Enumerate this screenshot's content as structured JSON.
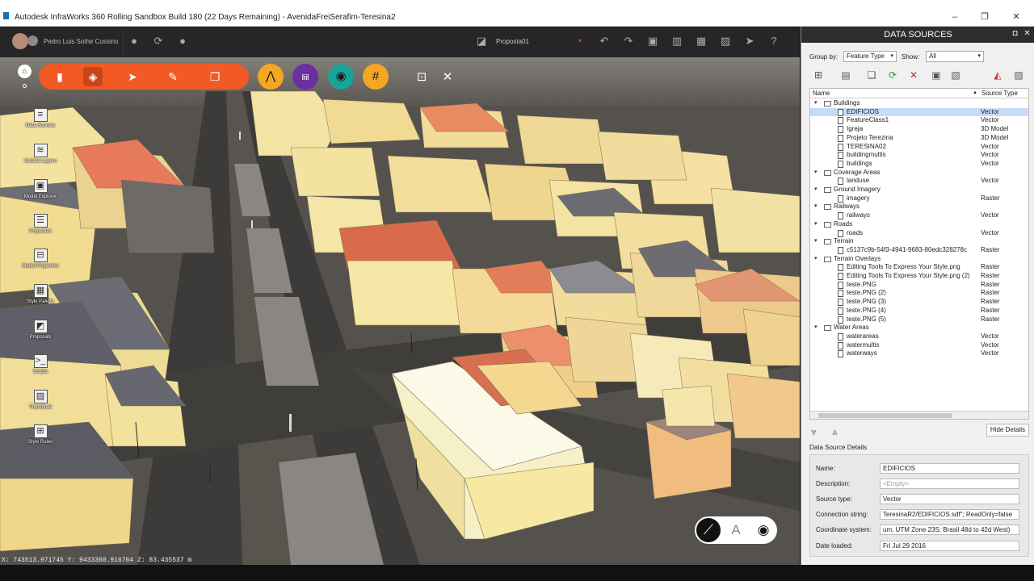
{
  "window": {
    "title": "Autodesk InfraWorks 360 Rolling Sandbox Build 180 (22 Days Remaining) - AvenidaFreiSerafim-Teresina2",
    "minimize": "–",
    "maximize": "❐",
    "close": "✕"
  },
  "topbar": {
    "user": "Pedro Luis Sothe Cussino",
    "proposal": "Proposta01",
    "proposal_caret": "▾"
  },
  "left_tools": [
    {
      "label": "Data Sources",
      "icon": "database-icon",
      "glyph": "≡"
    },
    {
      "label": "Surface Layers",
      "icon": "layers-icon",
      "glyph": "≋"
    },
    {
      "label": "Model Explorer",
      "icon": "model-explorer-icon",
      "glyph": "▣"
    },
    {
      "label": "Properties",
      "icon": "properties-icon",
      "glyph": "☰"
    },
    {
      "label": "Model Properties",
      "icon": "model-properties-icon",
      "glyph": "⊟"
    },
    {
      "label": "Style Palette",
      "icon": "style-palette-icon",
      "glyph": "▦"
    },
    {
      "label": "Proposals",
      "icon": "proposals-icon",
      "glyph": "◩"
    },
    {
      "label": "Scripts",
      "icon": "scripts-icon",
      "glyph": ">_"
    },
    {
      "label": "Thumbnail",
      "icon": "thumbnail-icon",
      "glyph": "▨"
    },
    {
      "label": "Style Rules",
      "icon": "style-rules-icon",
      "glyph": "⊞"
    }
  ],
  "coords": "X: 743513.971745  Y: 9433360.916764  Z: 83.435537 m",
  "panel": {
    "title": "DATA SOURCES",
    "group_by_label": "Group by:",
    "group_by_value": "Feature Type",
    "show_label": "Show:",
    "show_value": "All",
    "col_name": "Name",
    "col_type": "Source Type",
    "tree": [
      {
        "level": 0,
        "name": "Buildings",
        "type": ""
      },
      {
        "level": 1,
        "name": "EDIFICIOS",
        "type": "Vector",
        "selected": true
      },
      {
        "level": 1,
        "name": "FeatureClass1",
        "type": "Vector"
      },
      {
        "level": 1,
        "name": "Igreja",
        "type": "3D Model"
      },
      {
        "level": 1,
        "name": "Projeto Terezina",
        "type": "3D Model"
      },
      {
        "level": 1,
        "name": "TERESINA02",
        "type": "Vector"
      },
      {
        "level": 1,
        "name": "buildingmultis",
        "type": "Vector"
      },
      {
        "level": 1,
        "name": "buildings",
        "type": "Vector"
      },
      {
        "level": 0,
        "name": "Coverage Areas",
        "type": ""
      },
      {
        "level": 1,
        "name": "landuse",
        "type": "Vector"
      },
      {
        "level": 0,
        "name": "Ground Imagery",
        "type": ""
      },
      {
        "level": 1,
        "name": "imagery",
        "type": "Raster"
      },
      {
        "level": 0,
        "name": "Railways",
        "type": ""
      },
      {
        "level": 1,
        "name": "railways",
        "type": "Vector"
      },
      {
        "level": 0,
        "name": "Roads",
        "type": ""
      },
      {
        "level": 1,
        "name": "roads",
        "type": "Vector"
      },
      {
        "level": 0,
        "name": "Terrain",
        "type": ""
      },
      {
        "level": 1,
        "name": "c5137c9b-54f3-4941-9683-80edc328278c",
        "type": "Raster"
      },
      {
        "level": 0,
        "name": "Terrain Overlays",
        "type": ""
      },
      {
        "level": 1,
        "name": "Editing Tools To Express Your Style.png",
        "type": "Raster"
      },
      {
        "level": 1,
        "name": "Editing Tools To Express Your Style.png (2)",
        "type": "Raster"
      },
      {
        "level": 1,
        "name": "teste.PNG",
        "type": "Raster"
      },
      {
        "level": 1,
        "name": "teste.PNG (2)",
        "type": "Raster"
      },
      {
        "level": 1,
        "name": "teste.PNG (3)",
        "type": "Raster"
      },
      {
        "level": 1,
        "name": "teste.PNG (4)",
        "type": "Raster"
      },
      {
        "level": 1,
        "name": "teste.PNG (5)",
        "type": "Raster"
      },
      {
        "level": 0,
        "name": "Water Areas",
        "type": ""
      },
      {
        "level": 1,
        "name": "waterareas",
        "type": "Vector"
      },
      {
        "level": 1,
        "name": "watermultis",
        "type": "Vector"
      },
      {
        "level": 1,
        "name": "waterways",
        "type": "Vector"
      }
    ],
    "hide_details": "Hide Details",
    "details_title": "Data Source Details",
    "details": [
      {
        "label": "Name:",
        "value": "EDIFICIOS"
      },
      {
        "label": "Description:",
        "value": "<Empty>",
        "muted": true
      },
      {
        "label": "Source type:",
        "value": "Vector"
      },
      {
        "label": "Connection string:",
        "value": "TeresinaR2/EDIFICIOS.sdf\"; ReadOnly=false"
      },
      {
        "label": "Coordinate system:",
        "value": "um, UTM Zone 23S; Brasil 48d to 42d West)"
      },
      {
        "label": "Date loaded:",
        "value": "Fri Jul 29 2016"
      }
    ]
  }
}
